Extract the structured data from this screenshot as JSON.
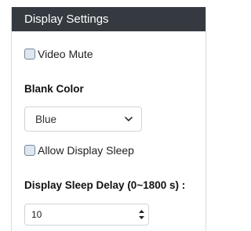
{
  "panel": {
    "title": "Display Settings"
  },
  "video_mute": {
    "label": "Video Mute",
    "checked": false
  },
  "blank_color": {
    "label": "Blank Color",
    "selected": "Blue"
  },
  "allow_display_sleep": {
    "label": "Allow Display Sleep",
    "checked": false
  },
  "display_sleep_delay": {
    "label": "Display Sleep Delay (0~1800 s) :",
    "value": "10"
  },
  "icons": {
    "select_chevron": "chevron-down-icon",
    "spinner": "spinner-arrows-icon"
  },
  "colors": {
    "header_bg": "#343a40",
    "header_text": "#ffffff",
    "checkbox_fill": "#dde7f2"
  }
}
